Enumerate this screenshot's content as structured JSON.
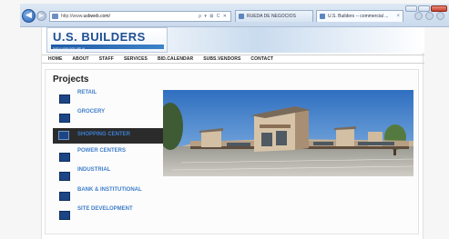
{
  "browser": {
    "url_prefix": "http://www.",
    "url_host": "usbweb.com/",
    "address_tools": "ρ ▾ ⊠ C ✕",
    "tabs": [
      {
        "label": "RUEDA DE NEGOCIOS"
      },
      {
        "label": "U.S. Builders -- commercial ..."
      }
    ]
  },
  "site": {
    "logo_title": "U.S. BUILDERS",
    "logo_tagline": "build a relationship with us"
  },
  "menu": {
    "items": [
      "HOME",
      "ABOUT",
      "STAFF",
      "SERVICES",
      "BID.CALENDAR",
      "SUBS.VENDORS",
      "CONTACT"
    ]
  },
  "projects": {
    "heading": "Projects",
    "items": [
      {
        "label": "RETAIL"
      },
      {
        "label": "GROCERY"
      },
      {
        "label": "SHOPPING CENTER"
      },
      {
        "label": "POWER CENTERS"
      },
      {
        "label": "INDUSTRIAL"
      },
      {
        "label": "BANK & INSTITUTIONAL"
      },
      {
        "label": "SITE DEVELOPMENT"
      }
    ],
    "active_index": 2
  },
  "colors": {
    "brand": "#1d4f94",
    "link": "#3f7ecb",
    "active_bg": "#2b2b2b"
  }
}
